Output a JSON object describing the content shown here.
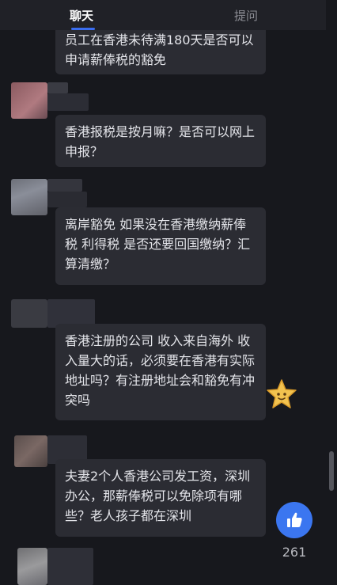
{
  "tabs": [
    {
      "label": "聊天",
      "active": true
    },
    {
      "label": "提问",
      "active": false
    }
  ],
  "messages": [
    {
      "text": "员工在香港未待满180天是否可以申请薪俸税的豁免"
    },
    {
      "text": "香港报税是按月嘛？是否可以网上申报？"
    },
    {
      "text": "离岸豁免 如果没在香港缴纳薪俸税 利得税 是否还要回国缴纳？汇算清缴？"
    },
    {
      "text": "香港注册的公司 收入来自海外 收入量大的话，必须要在香港有实际地址吗？有注册地址会和豁免有冲突吗"
    },
    {
      "text": "夫妻2个人香港公司发工资，深圳办公，那薪俸税可以免除项有哪些？老人孩子都在深圳"
    }
  ],
  "like": {
    "icon": "thumbs-up-icon",
    "count": "261"
  },
  "reaction": {
    "icon": "star-face-icon"
  },
  "colors": {
    "accent": "#3b76f0",
    "background": "#17181d",
    "bubble": "#2b2c33"
  }
}
